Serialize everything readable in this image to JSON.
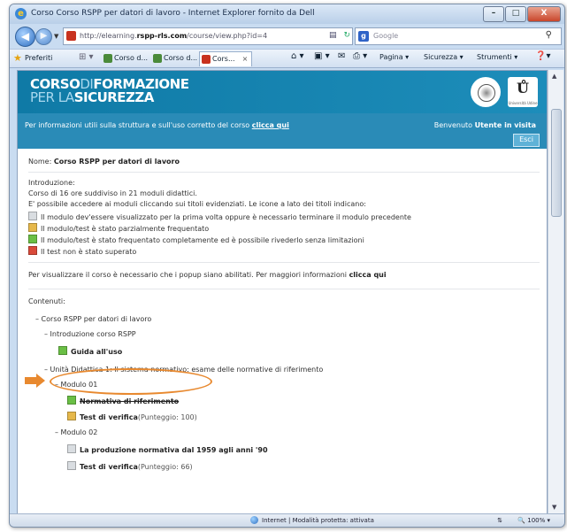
{
  "window": {
    "title": "Corso Corso RSPP per datori di lavoro - Internet Explorer fornito da Dell",
    "minimize": "–",
    "maximize": "□",
    "close": "X"
  },
  "nav": {
    "url_prefix": "http://elearning.",
    "url_domain": "rspp-rls.com",
    "url_path": "/course/view.php?id=4",
    "search_placeholder": "Google"
  },
  "favorites_bar": {
    "favorites_label": "Preferiti",
    "tabs": [
      {
        "label": "Corso d..."
      },
      {
        "label": "Corso d..."
      },
      {
        "label": "Cors..."
      }
    ],
    "tab_close": "×",
    "commands": {
      "page": "Pagina ▾",
      "security": "Sicurezza ▾",
      "tools": "Strumenti ▾"
    }
  },
  "site": {
    "logo_line1_bold": "CORSO",
    "logo_line1_light": "DI",
    "logo_line1_bold2": "FORMAZIONE",
    "logo_line2_light": "PER LA",
    "logo_line2_bold": "SICUREZZA",
    "emblem2_letter": "Ů",
    "emblem2_caption": "Università Udine",
    "info_text": "Per informazioni utili sulla struttura e sull'uso corretto del corso",
    "info_link": "clicca qui",
    "welcome_prefix": "Benvenuto",
    "welcome_user": "Utente in visita",
    "exit_button": "Esci"
  },
  "course": {
    "name_label": "Nome:",
    "name_value": "Corso RSPP per datori di lavoro",
    "intro_heading": "Introduzione:",
    "intro_line1": "Corso di 16 ore suddiviso in 21 moduli didattici.",
    "intro_line2": "E' possibile accedere ai moduli cliccando sui titoli evidenziati. Le icone a lato dei titoli indicano:",
    "legend": [
      {
        "color": "grey",
        "text": "Il modulo dev'essere visualizzato per la prima volta oppure è necessario terminare il modulo precedente"
      },
      {
        "color": "yellow",
        "text": "Il modulo/test è stato parzialmente frequentato"
      },
      {
        "color": "green",
        "text": "Il modulo/test è stato frequentato completamente ed è possibile rivederlo senza limitazioni"
      },
      {
        "color": "red",
        "text": "Il test non è stato superato"
      }
    ],
    "popup_text": "Per visualizzare il corso è necessario che i popup siano abilitati. Per maggiori informazioni",
    "popup_link": "clicca qui",
    "contents_heading": "Contenuti:"
  },
  "tree": {
    "root": "– Corso RSPP per datori di lavoro",
    "intro_section": "– Introduzione corso RSPP",
    "guide": "Guida all'uso",
    "unit1": "– Unità Didattica 1: Il sistema normativo: esame delle normative di riferimento",
    "module1": "– Modulo 01",
    "normativa": "Normativa di riferimento",
    "test1_title": "Test di verifica",
    "test1_score": "(Punteggio: 100)",
    "module2": "– Modulo 02",
    "production": "La produzione normativa dal 1959 agli anni '90",
    "test2_title": "Test di verifica",
    "test2_score": "(Punteggio: 66)"
  },
  "status": {
    "text": "Internet | Modalità protetta: attivata",
    "security_icon": "⇅",
    "zoom": "100%"
  },
  "colors": {
    "banner": "#0f7aa6",
    "infobar": "#2a8bb7",
    "highlight": "#e8892f"
  }
}
